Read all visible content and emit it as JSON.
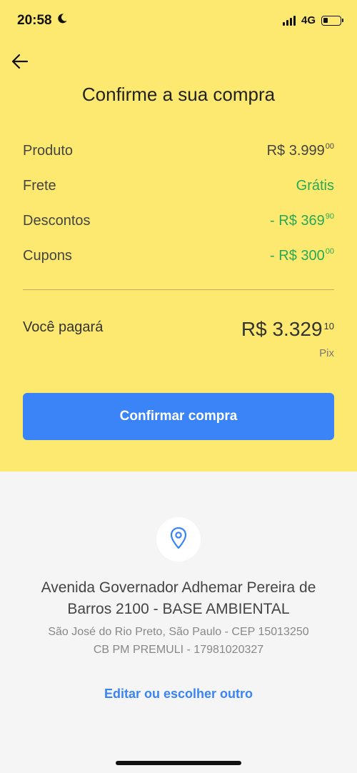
{
  "status_bar": {
    "time": "20:58",
    "network": "4G",
    "icons": [
      "moon-icon",
      "signal-icon",
      "battery-icon"
    ],
    "battery_level": 0.3
  },
  "header": {
    "back_icon": "arrow-left-icon",
    "title": "Confirme a sua compra"
  },
  "summary": {
    "rows": [
      {
        "label": "Produto",
        "value": "R$ 3.999",
        "cents": "00"
      },
      {
        "label": "Frete",
        "value": "Grátis",
        "cents": ""
      },
      {
        "label": "Descontos",
        "value": "- R$ 369",
        "cents": "90"
      },
      {
        "label": "Cupons",
        "value": "- R$ 300",
        "cents": "00"
      }
    ],
    "total_label": "Você pagará",
    "total_value": "R$ 3.329",
    "total_cents": "10",
    "payment_method": "Pix"
  },
  "confirm_button": {
    "label": "Confirmar compra"
  },
  "address": {
    "icon": "location-pin-icon",
    "line": "Avenida Governador Adhemar Pereira de Barros 2100 - BASE AMBIENTAL",
    "city": "São José do Rio Preto, São Paulo - CEP 15013250",
    "recipient": "CB PM PREMULI - 17981020327",
    "edit_link": "Editar ou escolher outro"
  },
  "colors": {
    "header_bg": "#fde96f",
    "accent": "#3a84f7",
    "green": "#29a858",
    "bottom_bg": "#f5f5f5"
  }
}
